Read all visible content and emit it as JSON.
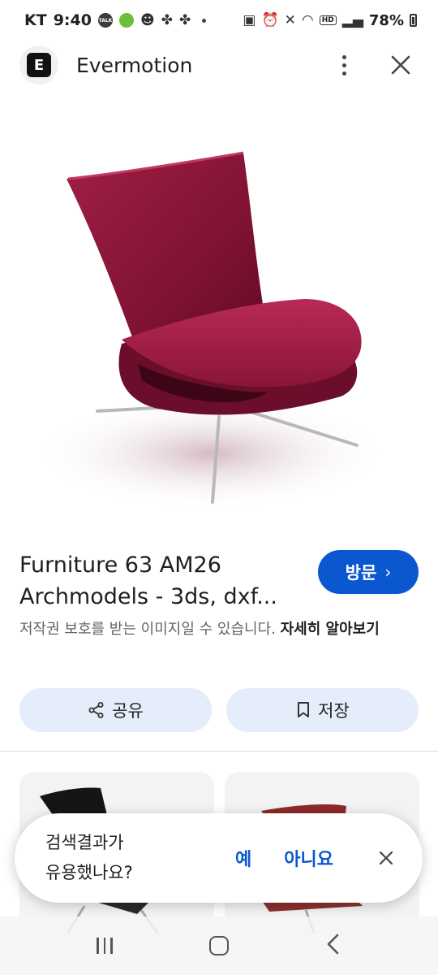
{
  "status_bar": {
    "carrier": "KT",
    "time": "9:40",
    "talk_badge": "TALK",
    "hd_badge": "HD",
    "battery": "78%"
  },
  "header": {
    "site_name": "Evermotion",
    "logo_letter": "E"
  },
  "result": {
    "title_line1": "Furniture 63 AM26",
    "title_line2": "Archmodels - 3ds, dxf...",
    "visit_label": "방문",
    "copyright_text": "저작권 보호를 받는 이미지일 수 있습니다.",
    "learn_more": "자세히 알아보기"
  },
  "actions": {
    "share_label": "공유",
    "save_label": "저장"
  },
  "feedback": {
    "question_line1": "검색결과가",
    "question_line2": "유용했나요?",
    "yes_label": "예",
    "no_label": "아니요"
  },
  "colors": {
    "accent": "#0b57d0",
    "pill_bg": "#e5edfa",
    "chair": "#8b1537"
  }
}
